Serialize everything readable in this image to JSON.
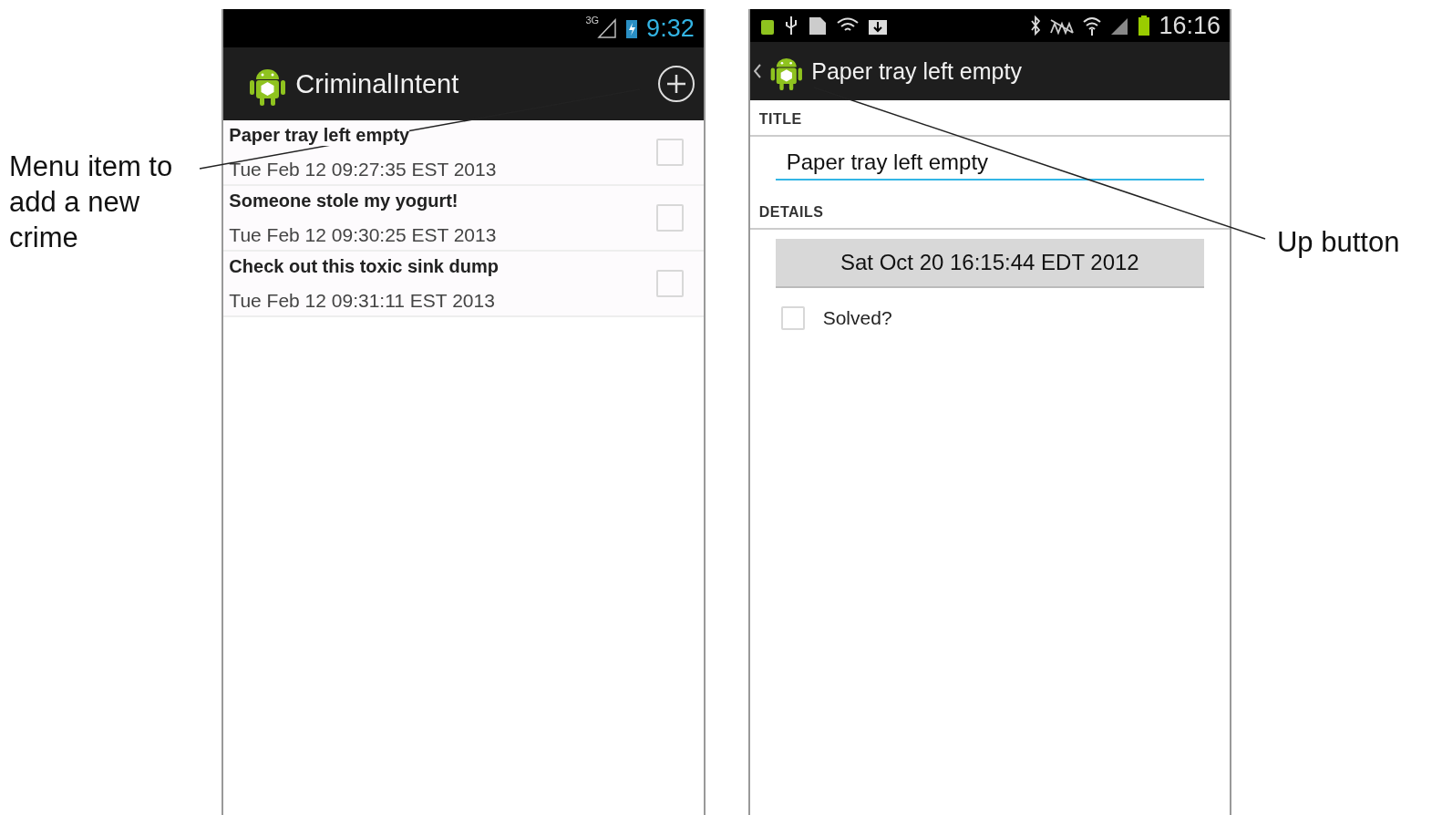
{
  "callouts": [
    {
      "text": "Menu item to add a new crime"
    },
    {
      "text": "Up button"
    }
  ],
  "list_screen": {
    "status_bar": {
      "network": "3G",
      "time": "9:32"
    },
    "action_bar": {
      "title": "CriminalIntent"
    },
    "crimes": [
      {
        "title": "Paper tray left empty",
        "date": "Tue Feb 12 09:27:35 EST 2013",
        "solved": false
      },
      {
        "title": "Someone stole my yogurt!",
        "date": "Tue Feb 12 09:30:25 EST 2013",
        "solved": false
      },
      {
        "title": "Check out this toxic sink dump",
        "date": "Tue Feb 12 09:31:11 EST 2013",
        "solved": false
      }
    ]
  },
  "detail_screen": {
    "status_bar": {
      "time": "16:16"
    },
    "action_bar": {
      "title": "Paper tray left empty"
    },
    "title_header": "TITLE",
    "title_field": {
      "value": "Paper tray left empty"
    },
    "details_header": "DETAILS",
    "date_button": "Sat Oct 20 16:15:44 EDT 2012",
    "solved": {
      "label": "Solved?",
      "checked": false
    }
  }
}
